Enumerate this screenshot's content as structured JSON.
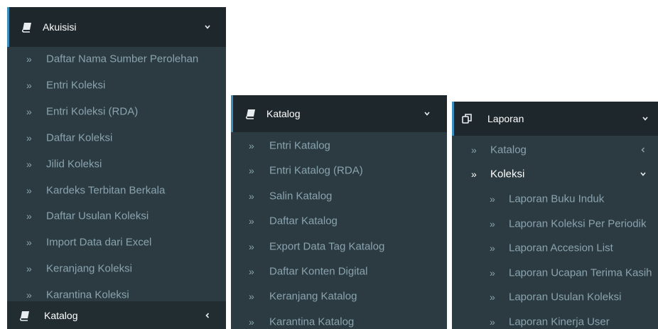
{
  "panel1": {
    "header": {
      "label": "Akuisisi",
      "icon": "book-icon",
      "chevron": "chevron-down-icon"
    },
    "items": [
      "Daftar Nama Sumber Perolehan",
      "Entri Koleksi",
      "Entri Koleksi (RDA)",
      "Daftar Koleksi",
      "Jilid Koleksi",
      "Kardeks Terbitan Berkala",
      "Daftar Usulan Koleksi",
      "Import Data dari Excel",
      "Keranjang Koleksi",
      "Karantina Koleksi"
    ],
    "footer": {
      "label": "Katalog",
      "icon": "book-icon",
      "chevron": "chevron-left-icon"
    }
  },
  "panel2": {
    "header": {
      "label": "Katalog",
      "icon": "book-icon",
      "chevron": "chevron-down-icon"
    },
    "items": [
      "Entri Katalog",
      "Entri Katalog (RDA)",
      "Salin Katalog",
      "Daftar Katalog",
      "Export Data Tag Katalog",
      "Daftar Konten Digital",
      "Keranjang Katalog",
      "Karantina Katalog"
    ]
  },
  "panel3": {
    "header": {
      "label": "Laporan",
      "icon": "copy-icon",
      "chevron": "chevron-down-icon"
    },
    "sub": [
      {
        "label": "Katalog",
        "chevron": "chevron-left-icon"
      },
      {
        "label": "Koleksi",
        "chevron": "chevron-down-icon"
      }
    ],
    "items": [
      "Laporan Buku Induk",
      "Laporan Koleksi Per Periodik",
      "Laporan Accesion List",
      "Laporan Ucapan Terima Kasih",
      "Laporan Usulan Koleksi",
      "Laporan Kinerja User"
    ]
  },
  "glyphs": {
    "arrow": "»"
  },
  "colors": {
    "header_bg": "#1e282c",
    "panel_bg": "#2c3b41",
    "accent": "#3c8dbc",
    "item_text": "#8aa4af"
  }
}
